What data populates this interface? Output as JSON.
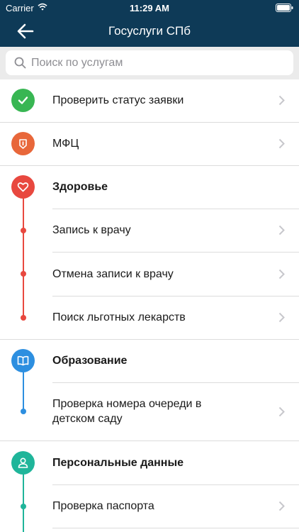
{
  "status_bar": {
    "carrier": "Carrier",
    "time": "11:29 AM"
  },
  "header": {
    "title": "Госуслуги СПб"
  },
  "search": {
    "placeholder": "Поиск по услугам"
  },
  "colors": {
    "header_bg": "#0e3a57",
    "green": "#38b653",
    "orange": "#e8673a",
    "red": "#e8483f",
    "blue": "#2d8fe0",
    "teal": "#1fb59a"
  },
  "items": {
    "check_status": "Проверить статус заявки",
    "mfc": "МФЦ",
    "health": {
      "title": "Здоровье",
      "items": [
        "Запись к врачу",
        "Отмена записи к врачу",
        "Поиск льготных лекарств"
      ]
    },
    "education": {
      "title": "Образование",
      "items": [
        {
          "line1": "Проверка номера очереди в",
          "line2": "детском саду"
        }
      ]
    },
    "personal": {
      "title": "Персональные данные",
      "items": [
        "Проверка паспорта"
      ]
    }
  }
}
